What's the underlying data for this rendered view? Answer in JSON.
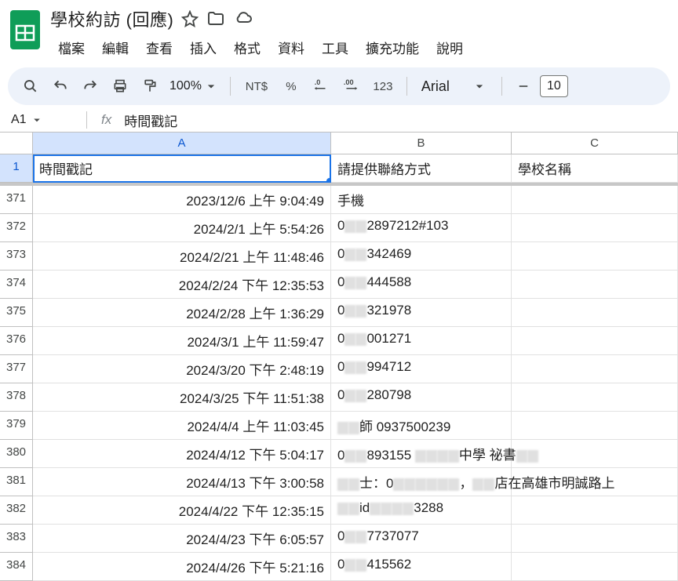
{
  "doc_title": "學校約訪 (回應)",
  "menus": [
    "檔案",
    "編輯",
    "查看",
    "插入",
    "格式",
    "資料",
    "工具",
    "擴充功能",
    "說明"
  ],
  "toolbar": {
    "zoom": "100%",
    "currency": "NT$",
    "percent": "%",
    "number_label": "123",
    "font_name": "Arial",
    "font_size": "10"
  },
  "formula_bar": {
    "cell_ref": "A1",
    "content": "時間戳記"
  },
  "columns": [
    "",
    "A",
    "B",
    "C"
  ],
  "frozen": {
    "row_num": "1",
    "a": "時間戳記",
    "b": "請提供聯絡方式",
    "c": "學校名稱"
  },
  "rows": [
    {
      "n": "371",
      "a": "2023/12/6 上午 9:04:49",
      "b": "手機",
      "c": ""
    },
    {
      "n": "372",
      "a": "2024/2/1 上午 5:54:26",
      "b": "0▒▒2897212#103",
      "c": ""
    },
    {
      "n": "373",
      "a": "2024/2/21 上午 11:48:46",
      "b": "0▒▒342469",
      "c": ""
    },
    {
      "n": "374",
      "a": "2024/2/24 下午 12:35:53",
      "b": "0▒▒444588",
      "c": ""
    },
    {
      "n": "375",
      "a": "2024/2/28 上午 1:36:29",
      "b": "0▒▒321978",
      "c": ""
    },
    {
      "n": "376",
      "a": "2024/3/1 上午 11:59:47",
      "b": "0▒▒001271",
      "c": ""
    },
    {
      "n": "377",
      "a": "2024/3/20 下午 2:48:19",
      "b": "0▒▒994712",
      "c": ""
    },
    {
      "n": "378",
      "a": "2024/3/25 下午 11:51:38",
      "b": "0▒▒280798",
      "c": ""
    },
    {
      "n": "379",
      "a": "2024/4/4 上午 11:03:45",
      "b": "▒▒師 0937500239",
      "c": ""
    },
    {
      "n": "380",
      "a": "2024/4/12 下午 5:04:17",
      "b": "0▒▒893155 ▒▒▒▒中學 祕書▒▒",
      "c": ""
    },
    {
      "n": "381",
      "a": "2024/4/13 下午 3:00:58",
      "b": "▒▒士：0▒▒▒▒▒▒，▒▒店在高雄市明誠路上",
      "c": ""
    },
    {
      "n": "382",
      "a": "2024/4/22 下午 12:35:15",
      "b": "▒▒id▒▒▒▒3288",
      "c": ""
    },
    {
      "n": "383",
      "a": "2024/4/23 下午 6:05:57",
      "b": "0▒▒7737077",
      "c": ""
    },
    {
      "n": "384",
      "a": "2024/4/26 下午 5:21:16",
      "b": "0▒▒415562",
      "c": ""
    }
  ]
}
